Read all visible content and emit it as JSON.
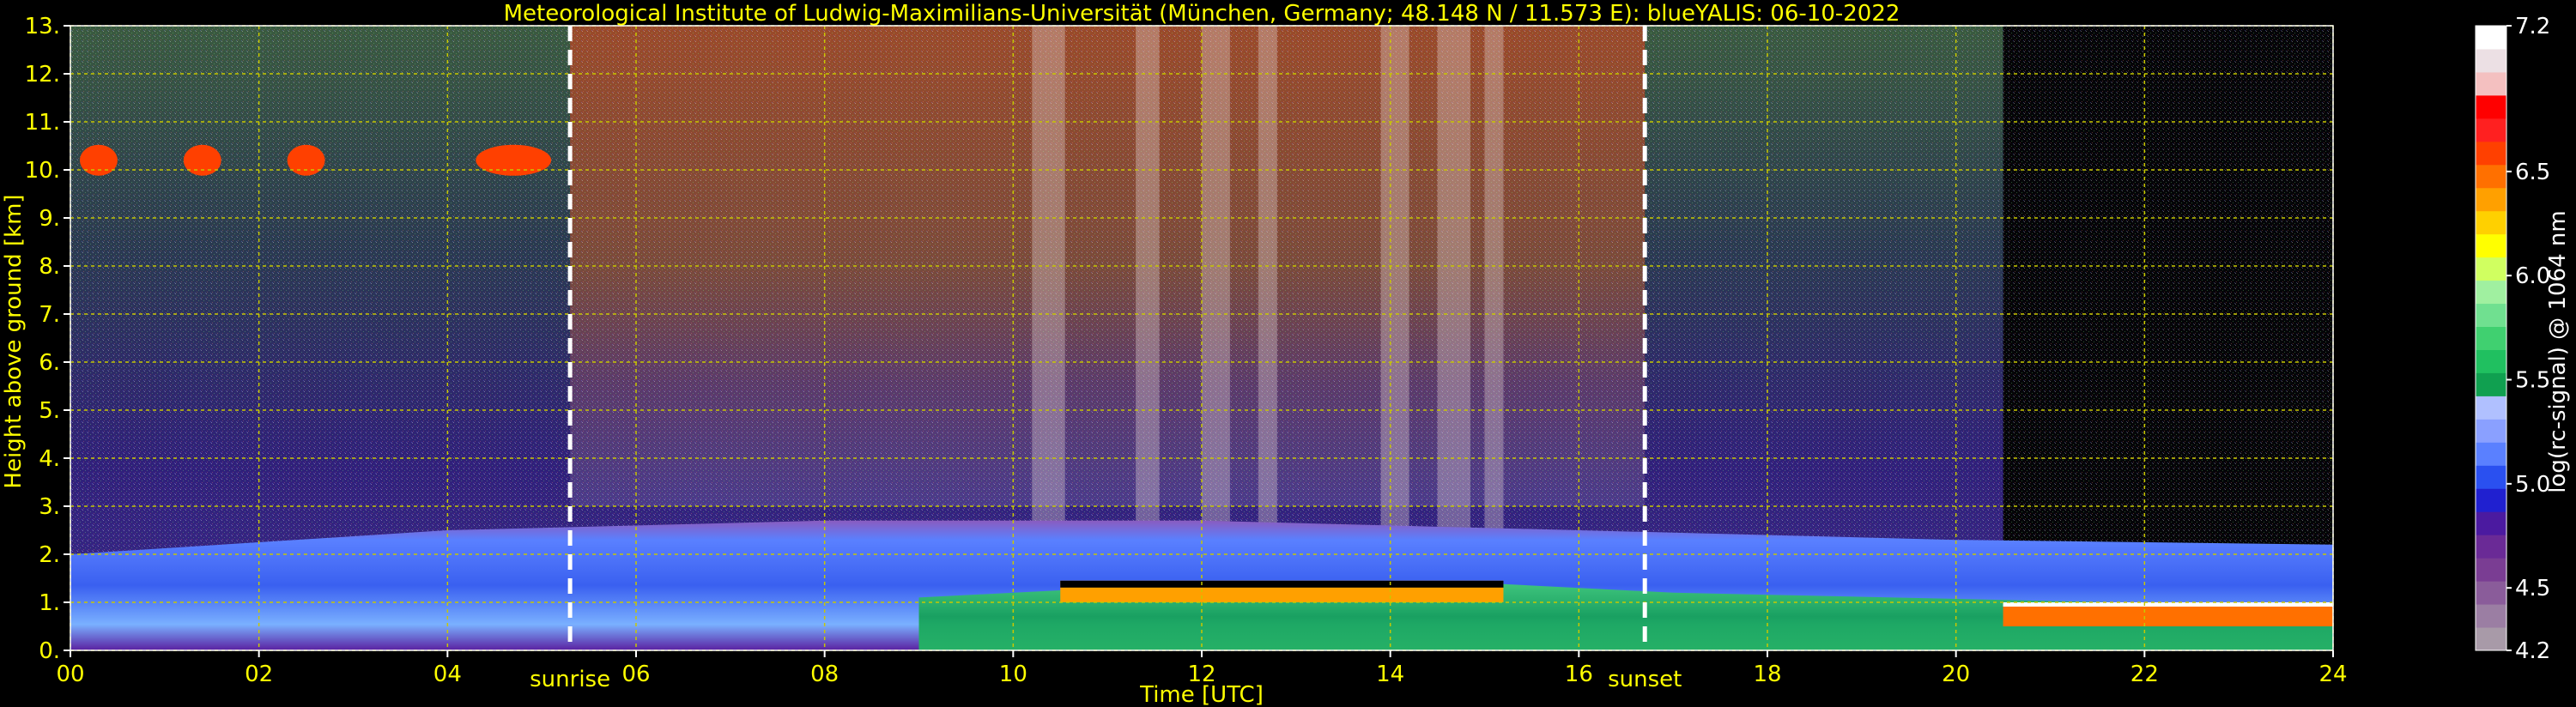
{
  "chart_data": {
    "type": "heatmap",
    "title": "Meteorological Institute of Ludwig-Maximilians-Universität (München, Germany; 48.148 N / 11.573 E):     blueYALIS: 06-10-2022",
    "xlabel": "Time [UTC]",
    "ylabel": "Height above ground [km]",
    "xlim": [
      0,
      24
    ],
    "ylim": [
      0,
      13
    ],
    "xticks": [
      0,
      2,
      4,
      6,
      8,
      10,
      12,
      14,
      16,
      18,
      20,
      22,
      24
    ],
    "xtick_labels": [
      "00",
      "02",
      "04",
      "06",
      "08",
      "10",
      "12",
      "14",
      "16",
      "18",
      "20",
      "22",
      "24"
    ],
    "yticks": [
      0,
      1,
      2,
      3,
      4,
      5,
      6,
      7,
      8,
      9,
      10,
      11,
      12,
      13
    ],
    "ytick_labels": [
      "0.",
      "1.",
      "2.",
      "3.",
      "4.",
      "5.",
      "6.",
      "7.",
      "8.",
      "9.",
      "10.",
      "11.",
      "12.",
      "13."
    ],
    "grid": true,
    "annotations": [
      {
        "x": 5.3,
        "label": "sunrise"
      },
      {
        "x": 16.7,
        "label": "sunset"
      }
    ],
    "colorbar": {
      "label": "log(rc-signal) @ 1064 nm",
      "range": [
        4.2,
        7.2
      ],
      "ticks": [
        4.2,
        4.5,
        5.0,
        5.5,
        6.0,
        6.5,
        7.2
      ],
      "tick_labels": [
        "4.2",
        "4.5",
        "5.0",
        "5.5",
        "6.0",
        "6.5",
        "7.2"
      ],
      "colors": [
        "#a89aa8",
        "#9b7ea3",
        "#8a5c9a",
        "#7a3d93",
        "#6a2a96",
        "#4b1aa0",
        "#2020d0",
        "#2a50f0",
        "#5a80ff",
        "#8aa0ff",
        "#b0c0ff",
        "#10a050",
        "#20c060",
        "#40d070",
        "#70e090",
        "#a0f0a0",
        "#d0ff60",
        "#ffff00",
        "#ffd000",
        "#ffa000",
        "#ff7000",
        "#ff4000",
        "#ff2020",
        "#ff0000",
        "#f4c0c0",
        "#ece0e4",
        "#ffffff"
      ]
    },
    "layers": [
      {
        "name": "boundary layer",
        "t_range": [
          0,
          24
        ],
        "top_km": [
          2.0,
          2.5,
          2.7,
          2.7,
          2.5,
          2.3,
          2.2
        ],
        "peak_value": 5.3
      },
      {
        "name": "elevated aerosol layer",
        "t_range": [
          10.5,
          15.2
        ],
        "height_km": 1.3,
        "peak_value": 6.5
      },
      {
        "name": "night surface layer",
        "t_range": [
          20.5,
          24
        ],
        "height_km": 0.8,
        "peak_value": 7.0
      },
      {
        "name": "cirrus",
        "t_range": [
          0,
          5.0
        ],
        "height_km": 10.2,
        "peak_value": 6.8
      }
    ],
    "text_labels": {
      "colorbar_label": "log(rc-signal) @ 1064 nm"
    },
    "colors": {
      "text": "#ffff00",
      "grid": "#c8c800",
      "marker": "#ffffff",
      "background": "#000000"
    }
  }
}
